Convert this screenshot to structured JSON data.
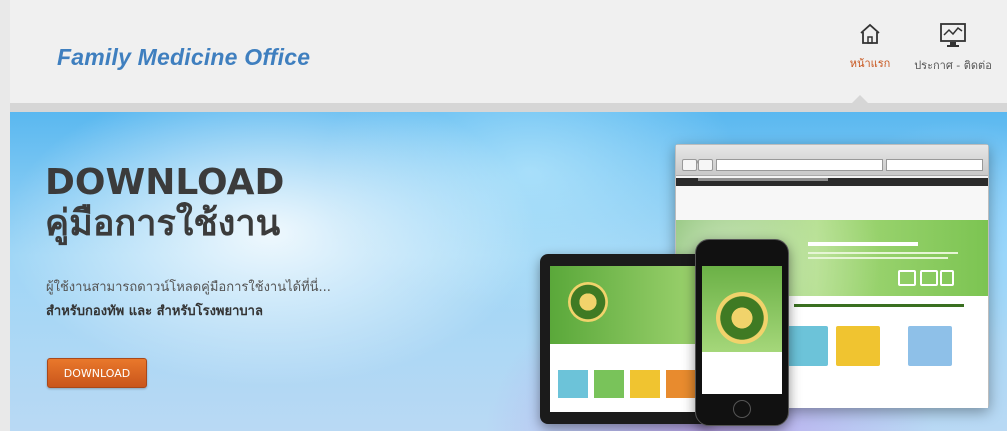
{
  "brand": {
    "title": "Family Medicine Office"
  },
  "nav": {
    "home_label": "หน้าแรก",
    "announce_label": "ประกาศ - ติดต่อ",
    "home_icon": "home-icon",
    "announce_icon": "chart-monitor-icon"
  },
  "hero": {
    "title_line1": "DOWNLOAD",
    "title_line2": "คู่มือการใช้งาน",
    "subtitle": "ผู้ใช้งานสามารถดาวน์โหลดคู่มือการใช้งานได้ที่นี่...",
    "subtitle_bold": "สำหรับกองทัพ และ สำหรับโรงพยาบาล",
    "download_label": "DOWNLOAD"
  },
  "colors": {
    "brand": "#3f7fbf",
    "active_nav": "#c8561e",
    "button": "#d9641f"
  }
}
